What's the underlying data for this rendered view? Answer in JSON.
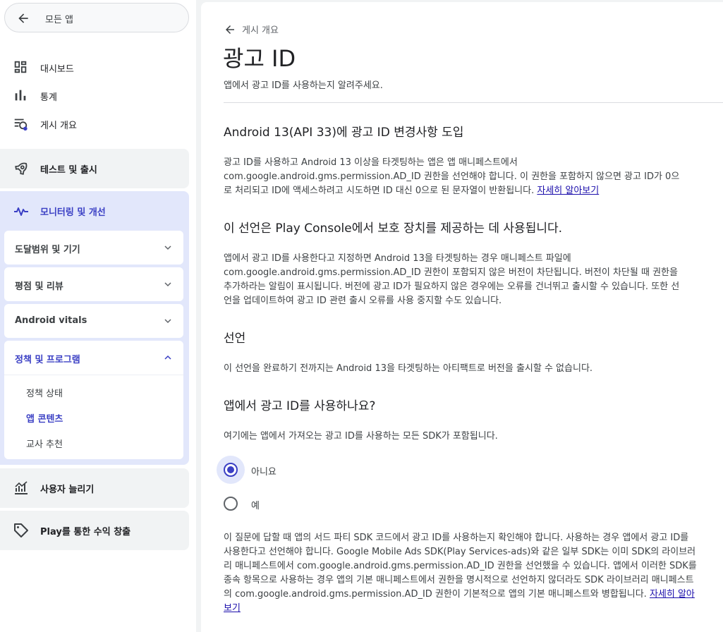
{
  "sidebar": {
    "back_label": "모든 앱",
    "nav": [
      {
        "label": "대시보드",
        "icon": "dashboard-icon"
      },
      {
        "label": "통계",
        "icon": "bar-chart-icon"
      },
      {
        "label": "게시 개요",
        "icon": "publishing-overview-icon"
      }
    ],
    "sections": {
      "test_release": {
        "label": "테스트 및 출시",
        "icon": "rocket-icon"
      },
      "monitor": {
        "label": "모니터링 및 개선",
        "icon": "pulse-icon",
        "items": [
          {
            "label": "도달범위 및 기기"
          },
          {
            "label": "평점 및 리뷰"
          },
          {
            "label": "Android vitals"
          },
          {
            "label": "정책 및 프로그램",
            "children": [
              "정책 상태",
              "앱 콘텐츠",
              "교사 추천"
            ]
          }
        ]
      },
      "grow": {
        "label": "사용자 늘리기",
        "icon": "growth-chart-icon"
      },
      "monetize": {
        "label": "Play를 통한 수익 창출",
        "icon": "tag-icon"
      }
    }
  },
  "main": {
    "breadcrumb": "게시 개요",
    "title": "광고 ID",
    "subtitle": "앱에서 광고 ID를 사용하는지 알려주세요.",
    "section1": {
      "heading": "Android 13(API 33)에 광고 ID 변경사항 도입",
      "line1": "광고 ID를 사용하고 Android 13 이상을 타겟팅하는 앱은 앱 매니페스트에서",
      "line2": "com.google.android.gms.permission.AD_ID 권한을 선언해야 합니다. 이 권한을 포함하지 않으면 광고 ID가 0으",
      "line3": "로 처리되고 ID에 액세스하려고 시도하면 ID 대신 0으로 된 문자열이 반환됩니다. ",
      "link": "자세히 알아보기"
    },
    "section2": {
      "heading": "이 선언은 Play Console에서 보호 장치를 제공하는 데 사용됩니다.",
      "line1": "앱에서 광고 ID를 사용한다고 지정하면 Android 13을 타겟팅하는 경우 매니페스트 파일에",
      "line2": "com.google.android.gms.permission.AD_ID 권한이 포함되지 않은 버전이 차단됩니다. 버전이 차단될 때 권한을",
      "line3": "추가하라는 알림이 표시됩니다. 버전에 광고 ID가 필요하지 않은 경우에는 오류를 건너뛰고 출시할 수 있습니다. 또한 선",
      "line4": "언을 업데이트하여 광고 ID 관련 출시 오류를 사용 중지할 수도 있습니다."
    },
    "section3": {
      "heading": "선언",
      "text": "이 선언을 완료하기 전까지는 Android 13을 타겟팅하는 아티팩트로 버전을 출시할 수 없습니다."
    },
    "question": {
      "heading": "앱에서 광고 ID를 사용하나요?",
      "hint": "여기에는 앱에서 가져오는 광고 ID를 사용하는 모든 SDK가 포함됩니다.",
      "options": [
        {
          "label": "아니요",
          "selected": true
        },
        {
          "label": "예",
          "selected": false
        }
      ]
    },
    "note": {
      "line1": "이 질문에 답할 때 앱의 서드 파티 SDK 코드에서 광고 ID를 사용하는지 확인해야 합니다. 사용하는 경우 앱에서 광고 ID를",
      "line2": "사용한다고 선언해야 합니다. Google Mobile Ads SDK(Play Services-ads)와 같은 일부 SDK는 이미 SDK의 라이브러",
      "line3": "리 매니페스트에서 com.google.android.gms.permission.AD_ID 권한을 선언했을 수 있습니다. 앱에서 이러한 SDK를",
      "line4": "종속 항목으로 사용하는 경우 앱의 기본 매니페스트에서 권한을 명시적으로 선언하지 않더라도 SDK 라이브러리 매니페스트",
      "line5": "의 com.google.android.gms.permission.AD_ID 권한이 기본적으로 앱의 기본 매니페스트와 병합됩니다. ",
      "link_part1": "자세히 알아",
      "link_part2": "보기"
    }
  },
  "colors": {
    "accent": "#3a3fc4",
    "active_section_bg": "#e2e7fb",
    "link": "#1a0dab"
  }
}
